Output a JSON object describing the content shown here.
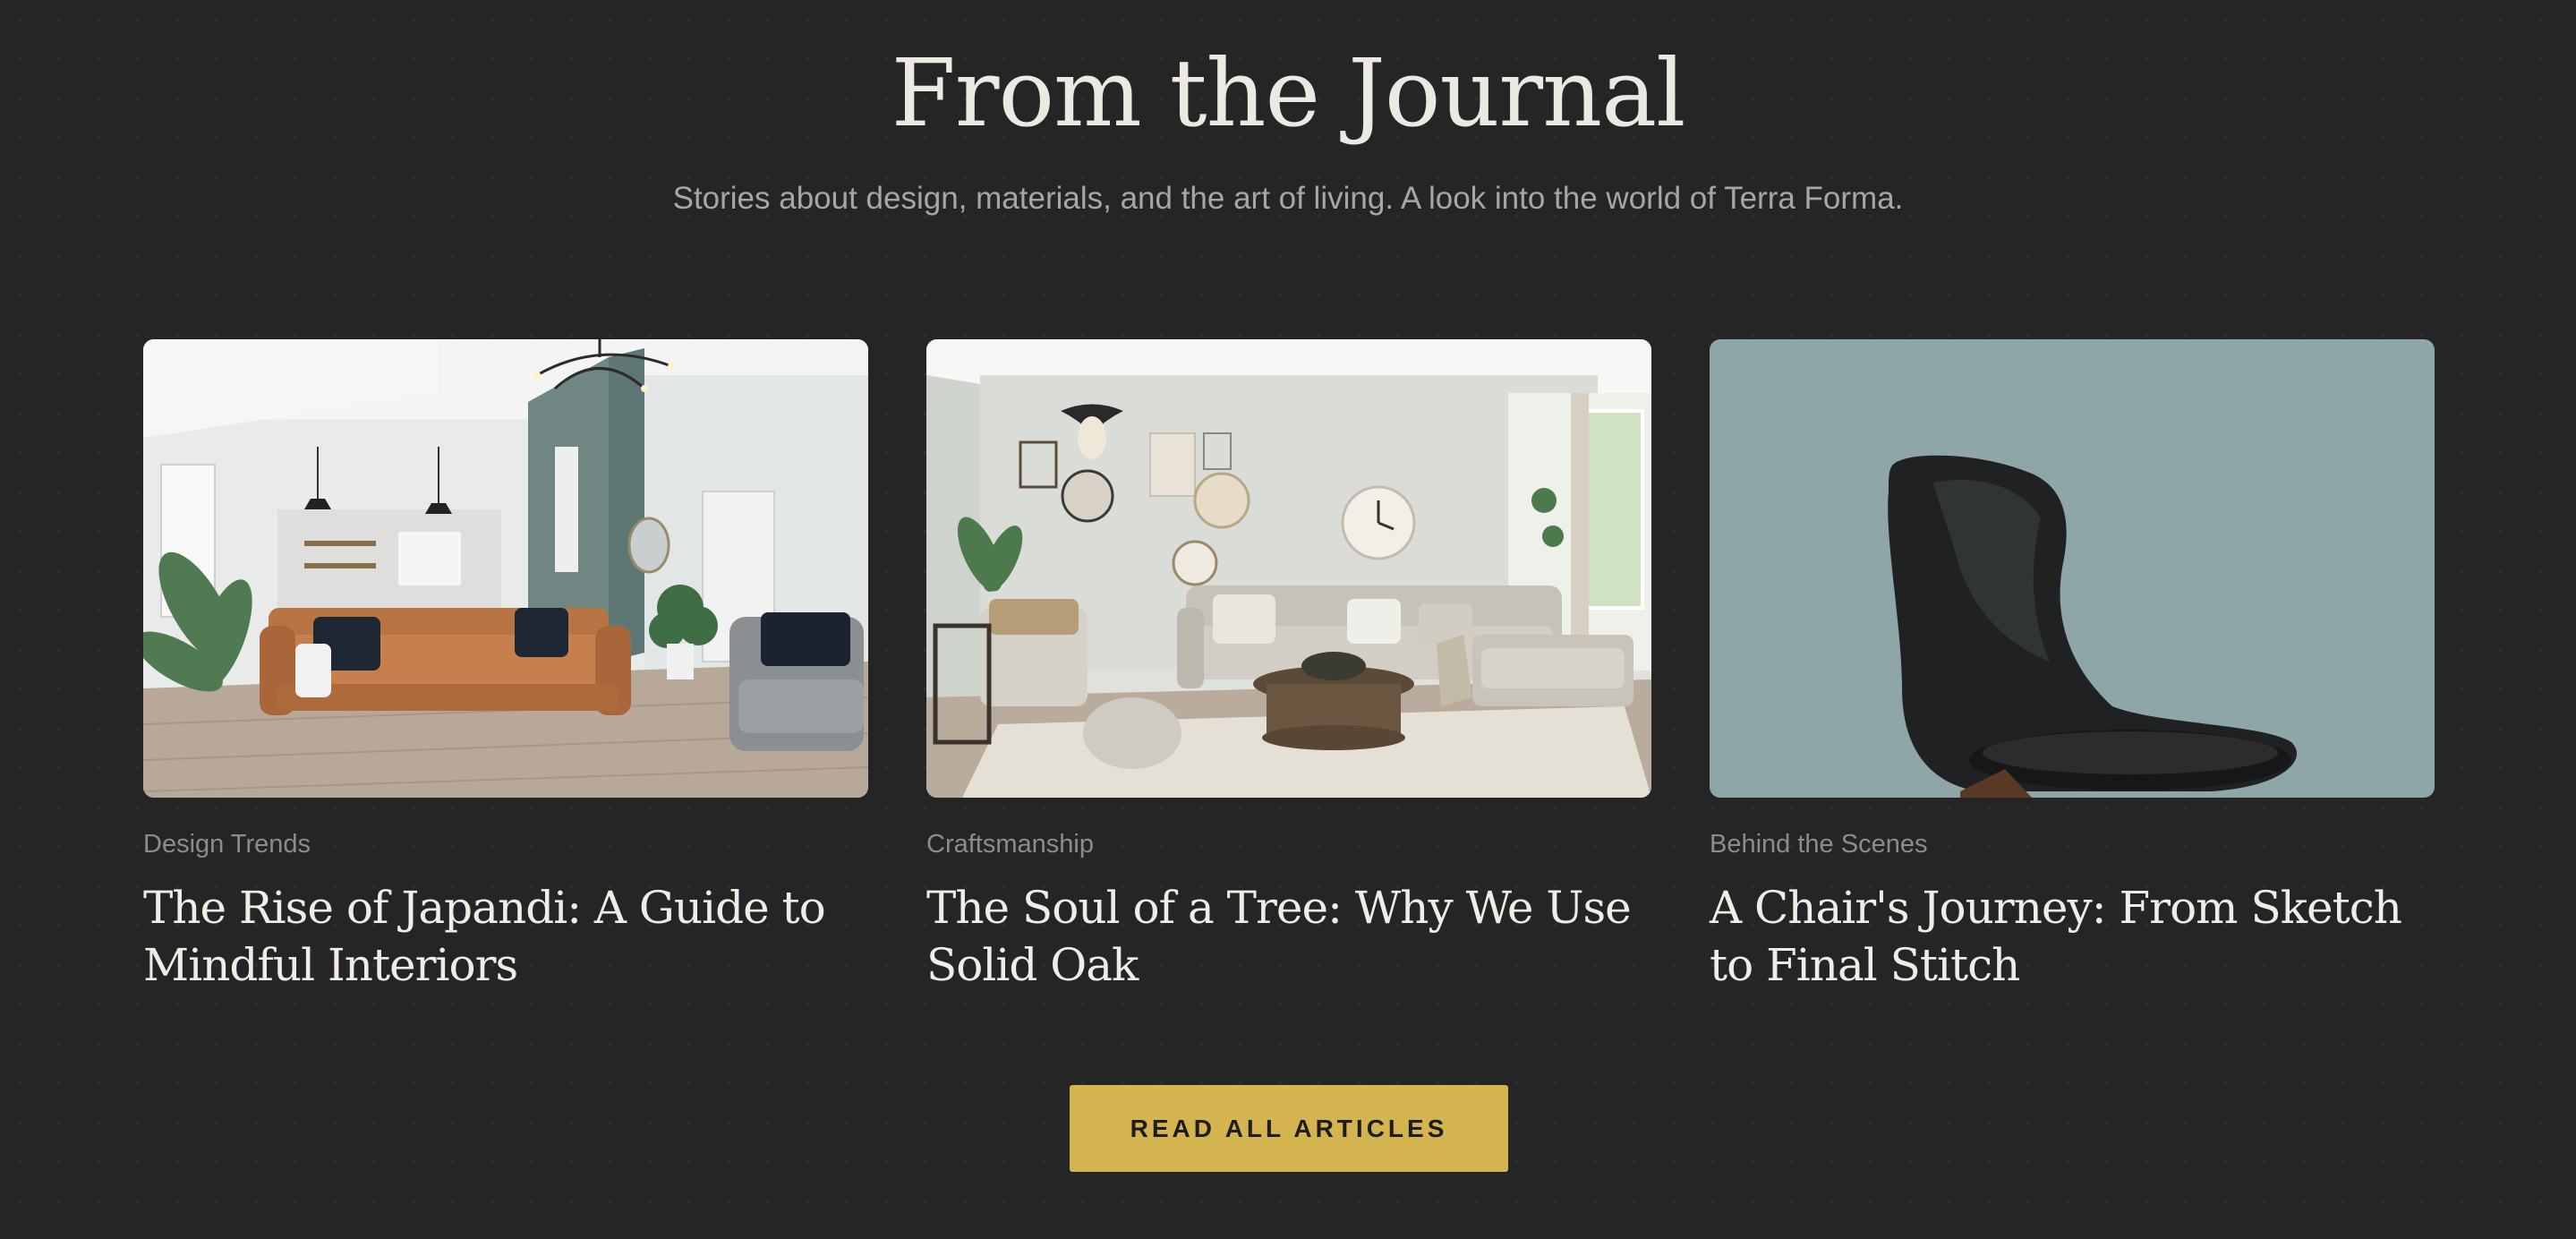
{
  "section": {
    "heading": "From the Journal",
    "subtitle": "Stories about design, materials, and the art of living. A look into the world of Terra Forma."
  },
  "articles": [
    {
      "category": "Design Trends",
      "title": "The Rise of Japandi: A Guide to Mindful Interiors",
      "image": "living-room-leather-sofa-photo"
    },
    {
      "category": "Craftsmanship",
      "title": "The Soul of a Tree: Why We Use Solid Oak",
      "image": "living-room-sectional-sofa-photo"
    },
    {
      "category": "Behind the Scenes",
      "title": "A Chair's Journey: From Sketch to Final Stitch",
      "image": "black-chair-photo"
    }
  ],
  "cta": {
    "label": "READ ALL ARTICLES"
  },
  "colors": {
    "background": "#252525",
    "accent": "#d4b44e",
    "heading": "#ece8e2",
    "muted": "#8c8c8c"
  }
}
